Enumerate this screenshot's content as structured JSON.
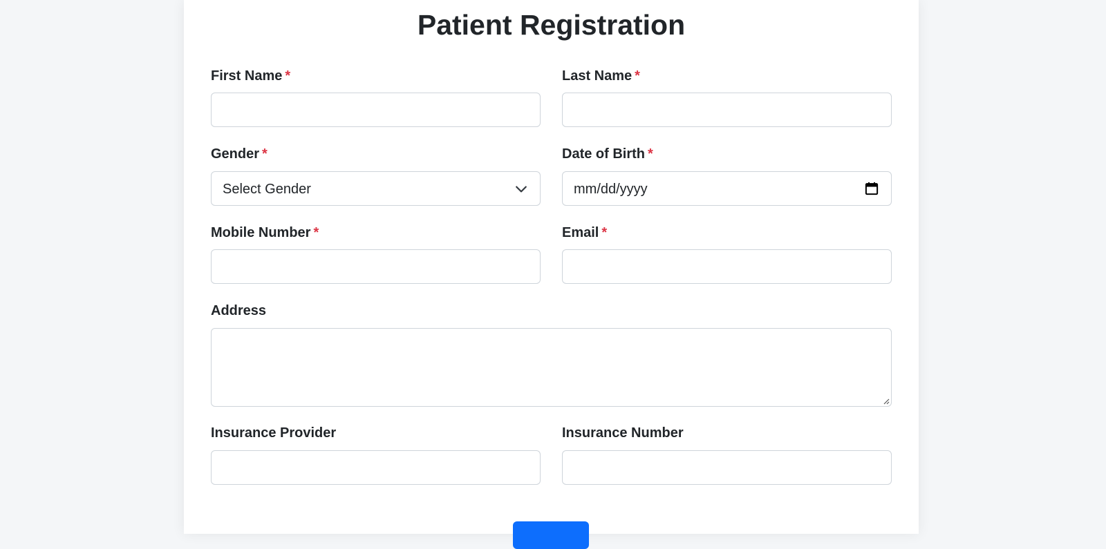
{
  "page": {
    "title": "Patient Registration"
  },
  "form": {
    "required_marker": "*",
    "first_name": {
      "label": "First Name",
      "value": ""
    },
    "last_name": {
      "label": "Last Name",
      "value": ""
    },
    "gender": {
      "label": "Gender",
      "selected": "Select Gender"
    },
    "date_of_birth": {
      "label": "Date of Birth",
      "placeholder": "mm/dd/yyyy"
    },
    "mobile_number": {
      "label": "Mobile Number",
      "value": ""
    },
    "email": {
      "label": "Email",
      "value": ""
    },
    "address": {
      "label": "Address",
      "value": ""
    },
    "insurance_provider": {
      "label": "Insurance Provider",
      "value": ""
    },
    "insurance_number": {
      "label": "Insurance Number",
      "value": ""
    }
  },
  "colors": {
    "accent": "#0d6efd",
    "required": "#dc3545",
    "border": "#ced4da",
    "background": "#f4f6f8"
  },
  "icons": {
    "select": "chevron-down-icon",
    "date": "calendar-icon",
    "textarea": "resize-handle-icon"
  }
}
